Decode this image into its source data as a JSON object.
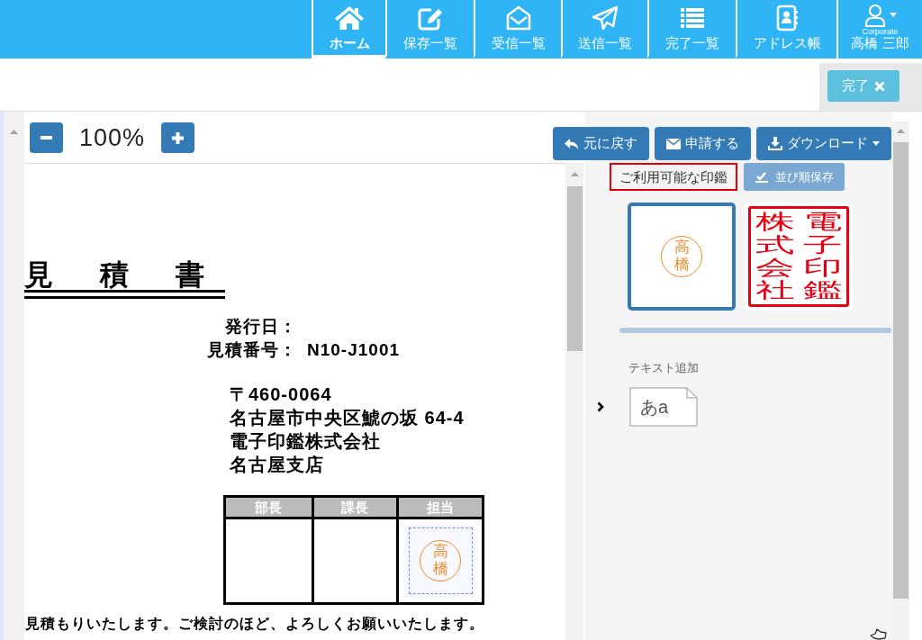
{
  "nav": {
    "items": [
      {
        "label": "ホーム",
        "selected": true
      },
      {
        "label": "保存一覧",
        "selected": false
      },
      {
        "label": "受信一覧",
        "selected": false
      },
      {
        "label": "送信一覧",
        "selected": false
      },
      {
        "label": "完了一覧",
        "selected": false
      },
      {
        "label": "アドレス帳",
        "selected": false
      }
    ],
    "user": {
      "caption": "Corporate",
      "name": "高橋 三郎"
    }
  },
  "top_bar": {
    "done_button": "完了"
  },
  "zoom": {
    "value": "100%"
  },
  "actions": [
    {
      "label": "元に戻す",
      "kind": "undo",
      "dropdown": false
    },
    {
      "label": "申請する",
      "kind": "send",
      "dropdown": false
    },
    {
      "label": "ダウンロード",
      "kind": "download",
      "dropdown": true
    }
  ],
  "document": {
    "title": "見　積　書",
    "fields": [
      {
        "label": "発行日："
      },
      {
        "label": "見積番号：",
        "value": "N10-J1001"
      }
    ],
    "address": [
      "〒460-0064",
      "名古屋市中央区鯱の坂 64-4",
      "電子印鑑株式会社",
      "名古屋支店"
    ],
    "approval": [
      {
        "role": "部長"
      },
      {
        "role": "課長"
      },
      {
        "role": "担当",
        "stamp": {
          "kind": "round",
          "columns": [
            "高橋"
          ],
          "selected": true
        }
      }
    ],
    "closing": "見積もりいたします。ご検討のほど、よろしくお願いいたします。"
  },
  "panel": {
    "heading": {
      "label": "ご利用可能な印鑑",
      "highlighted": true
    },
    "save_order_button": {
      "label": "並び順保存",
      "disabled": true
    },
    "stamps": [
      {
        "kind": "round",
        "selected": true,
        "columns": [
          "高橋"
        ]
      },
      {
        "kind": "square",
        "selected": false,
        "columns": [
          "株式会社",
          "電子印鑑"
        ]
      }
    ],
    "text_add": {
      "heading": "テキスト追加",
      "sample": "あa"
    }
  }
}
